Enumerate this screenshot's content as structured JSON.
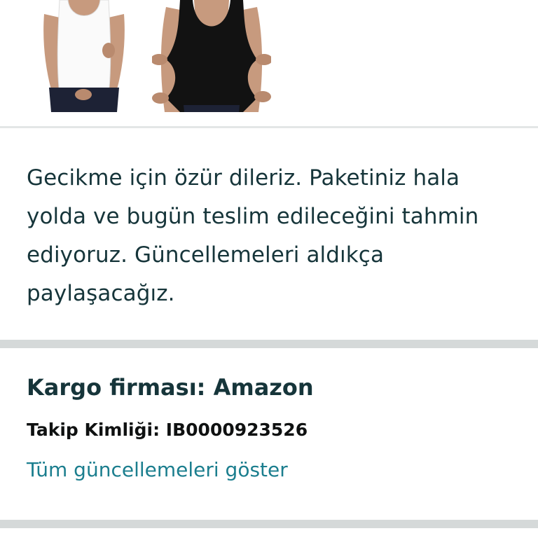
{
  "products": {
    "items": [
      {
        "icon": "white-tank-top-product-image"
      },
      {
        "icon": "black-tank-top-product-image"
      }
    ]
  },
  "status": {
    "message": "Gecikme için özür dileriz. Paketiniz hala yolda ve bugün teslim edileceğini tahmin ediyoruz. Güncellemeleri aldıkça paylaşacağız."
  },
  "carrier": {
    "title": "Kargo firması: Amazon",
    "tracking_id": "Takip Kimliği: IB0000923526",
    "show_updates_link": "Tüm güncellemeleri göster"
  },
  "colors": {
    "link": "#1b7e8e",
    "text": "#16353a",
    "divider": "#d5d9d9"
  }
}
